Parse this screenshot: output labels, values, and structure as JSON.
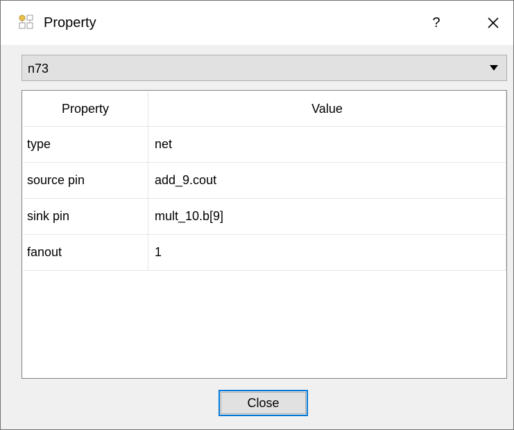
{
  "window": {
    "title": "Property",
    "help_label": "?",
    "icon": "property-sheet-icon",
    "close_icon": "close-icon"
  },
  "selector": {
    "selected": "n73"
  },
  "table": {
    "headers": [
      "Property",
      "Value"
    ],
    "rows": [
      {
        "property": "type",
        "value": "net"
      },
      {
        "property": "source pin",
        "value": "add_9.cout"
      },
      {
        "property": "sink pin",
        "value": "mult_10.b[9]"
      },
      {
        "property": "fanout",
        "value": "1"
      }
    ]
  },
  "footer": {
    "close_label": "Close"
  },
  "colors": {
    "accent": "#0078d7",
    "window_bg": "#f0f0f0",
    "button_bg": "#e1e1e1"
  }
}
